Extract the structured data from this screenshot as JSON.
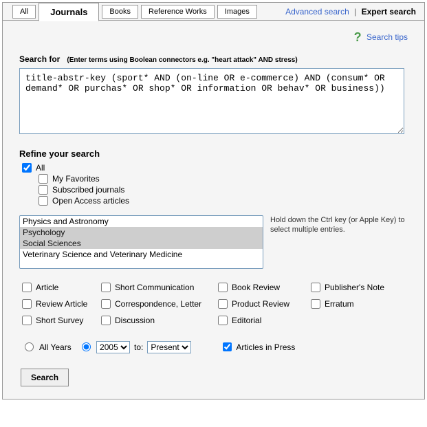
{
  "tabs": {
    "all": "All",
    "journals": "Journals",
    "books": "Books",
    "reference": "Reference Works",
    "images": "Images"
  },
  "links": {
    "advanced": "Advanced search",
    "expert": "Expert search",
    "separator": "|",
    "tips": "Search tips"
  },
  "search": {
    "label": "Search for",
    "hint": "(Enter terms using Boolean connectors e.g. \"heart attack\" AND stress)",
    "value": "title-abstr-key (sport* AND (on-line OR e-commerce) AND (consum* OR demand* OR purchas* OR shop* OR information OR behav* OR business))"
  },
  "refine": {
    "heading": "Refine your search",
    "all": "All",
    "favorites": "My Favorites",
    "subscribed": "Subscribed journals",
    "open_access": "Open Access articles"
  },
  "subjects": {
    "hint": "Hold down the Ctrl key (or Apple Key) to select multiple entries.",
    "opt0": "Physics and Astronomy",
    "opt1": "Psychology",
    "opt2": "Social Sciences",
    "opt3": "Veterinary Science and Veterinary Medicine"
  },
  "types": {
    "article": "Article",
    "short_comm": "Short Communication",
    "book_review": "Book Review",
    "pub_note": "Publisher's Note",
    "review_article": "Review Article",
    "corr_letter": "Correspondence, Letter",
    "product_review": "Product Review",
    "erratum": "Erratum",
    "short_survey": "Short Survey",
    "discussion": "Discussion",
    "editorial": "Editorial"
  },
  "years": {
    "all": "All Years",
    "from": "2005",
    "to_label": "to:",
    "to": "Present",
    "press": "Articles in Press"
  },
  "button": {
    "search": "Search"
  }
}
